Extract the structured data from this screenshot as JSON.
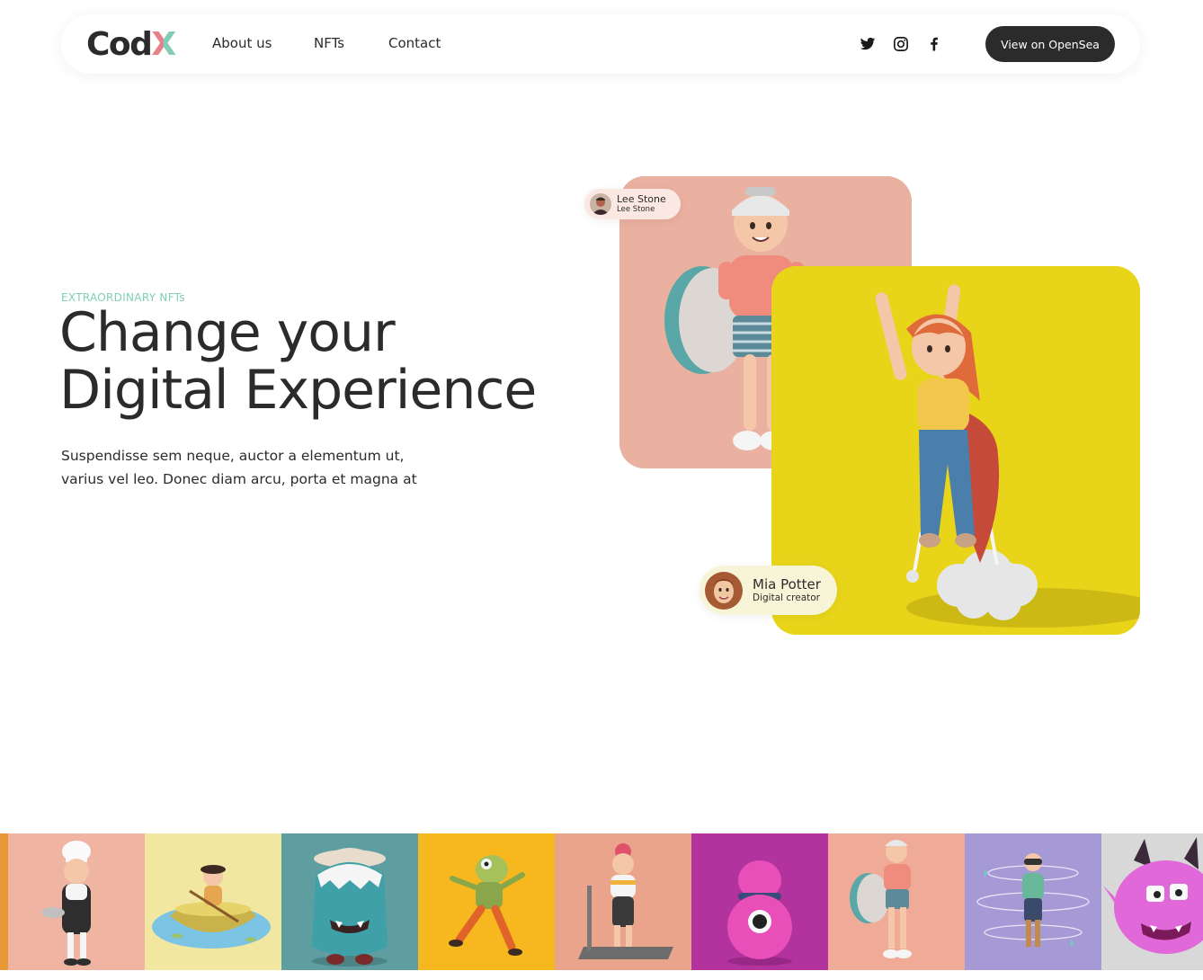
{
  "nav": {
    "logo": {
      "main": "Cod",
      "accent": "X"
    },
    "menu": [
      {
        "label": "About us"
      },
      {
        "label": "NFTs"
      },
      {
        "label": "Contact"
      }
    ],
    "social": [
      "twitter-icon",
      "instagram-icon",
      "facebook-icon"
    ],
    "cta_label": "View on OpenSea"
  },
  "hero": {
    "eyebrow": "EXTRAORDINARY NFTs",
    "title_line1": "Change your",
    "title_line2": "Digital Experience",
    "description": "Suspendisse sem neque, auctor a elementum ut, varius vel leo. Donec diam arcu, porta et magna at"
  },
  "cards": {
    "creator1": {
      "name": "Lee Stone",
      "role": "Lee Stone"
    },
    "creator2": {
      "name": "Mia Potter",
      "role": "Digital creator"
    }
  },
  "colors": {
    "text": "#2b2b2b",
    "accent_green": "#7fcfb4",
    "accent_pink": "#e8808a",
    "card_pink": "#eab0a0",
    "card_yellow": "#e8d51a",
    "button_dark": "#2b2b2b"
  },
  "gallery": [
    {
      "name": "chef-character",
      "bg": "#f0b5a2"
    },
    {
      "name": "rowboat-character",
      "bg": "#f1e7a0"
    },
    {
      "name": "blue-monster-with-hat",
      "bg": "#5f9ea0"
    },
    {
      "name": "frog-runner",
      "bg": "#f7b81f"
    },
    {
      "name": "treadmill-girl",
      "bg": "#eaa48c"
    },
    {
      "name": "pink-cyclops-blob",
      "bg": "#b2329e"
    },
    {
      "name": "surfer-boy",
      "bg": "#f0aa98"
    },
    {
      "name": "vr-character-rings",
      "bg": "#a69ad6"
    },
    {
      "name": "pink-devil-monster",
      "bg": "#d8d8d8"
    }
  ]
}
